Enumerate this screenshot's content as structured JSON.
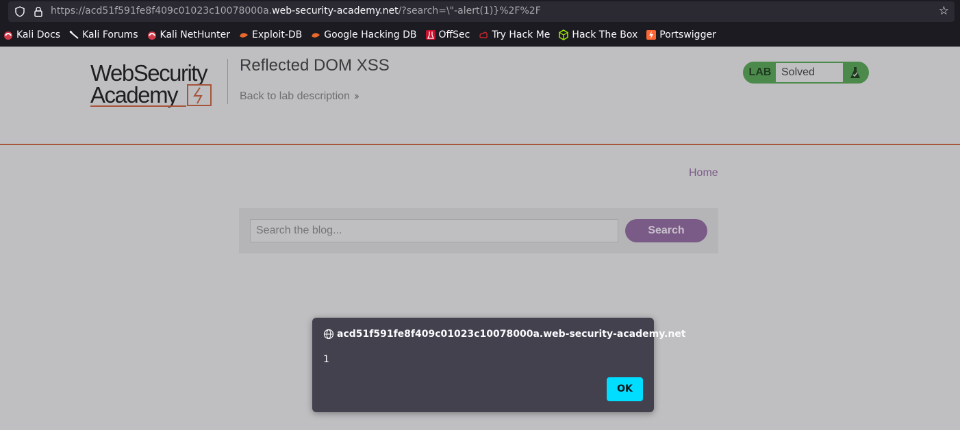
{
  "browser": {
    "url_prefix": "https://acd51f591fe8f409c01023c10078000a.",
    "url_host": "web-security-academy.net",
    "url_suffix": "/?search=\\\"-alert(1)}%2F%2F",
    "bookmarks": [
      {
        "label": "Kali Docs",
        "icon": "kali-dragon-icon"
      },
      {
        "label": "Kali Forums",
        "icon": "kali-forums-icon"
      },
      {
        "label": "Kali NetHunter",
        "icon": "kali-dragon-icon"
      },
      {
        "label": "Exploit-DB",
        "icon": "exploitdb-icon"
      },
      {
        "label": "Google Hacking DB",
        "icon": "exploitdb-icon"
      },
      {
        "label": "OffSec",
        "icon": "offsec-icon"
      },
      {
        "label": "Try Hack Me",
        "icon": "tryhackme-icon"
      },
      {
        "label": "Hack The Box",
        "icon": "hackthebox-icon"
      },
      {
        "label": "Portswigger",
        "icon": "portswigger-icon"
      }
    ]
  },
  "header": {
    "logo_line1": "WebSecurity",
    "logo_line2": "Academy",
    "lab_title": "Reflected DOM XSS",
    "back_link": "Back to lab description",
    "status_badge": "LAB",
    "status_text": "Solved"
  },
  "nav": {
    "home": "Home"
  },
  "search": {
    "placeholder": "Search the blog...",
    "button": "Search"
  },
  "dialog": {
    "origin": "acd51f591fe8f409c01023c10078000a.web-security-academy.net",
    "message": "1",
    "ok": "OK"
  },
  "colors": {
    "accent_orange": "#a6543a",
    "status_green": "#4c8a4c",
    "button_purple": "#7a5a86",
    "ok_cyan": "#00ddff"
  }
}
